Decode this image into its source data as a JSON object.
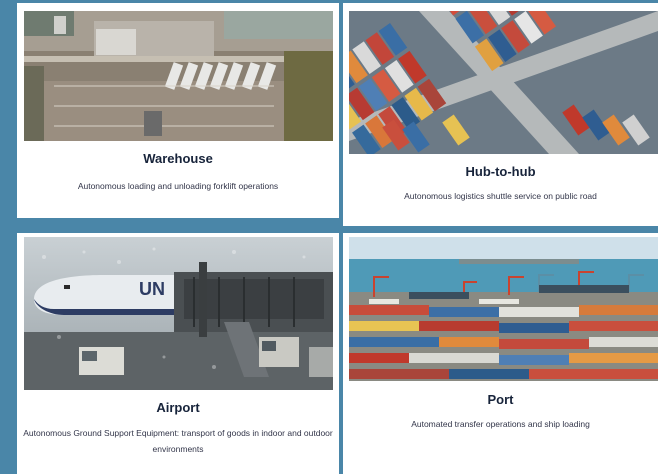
{
  "cards": [
    {
      "title": "Warehouse",
      "description": "Autonomous loading and unloading forklift operations",
      "image_alt": "Aerial view of a warehouse loading area with trucks"
    },
    {
      "title": "Hub-to-hub",
      "description": "Autonomous logistics shuttle service on public road",
      "image_alt": "Aerial view of stacked shipping containers"
    },
    {
      "title": "Airport",
      "description": "Autonomous Ground Support Equipment: transport of goods in indoor and outdoor environments",
      "image_alt": "Airplane at a gate on a rainy tarmac"
    },
    {
      "title": "Port",
      "description": "Automated transfer operations and ship loading",
      "image_alt": "Container port with cranes and ships"
    }
  ],
  "colors": {
    "background": "#4a86a8",
    "card": "#ffffff",
    "title": "#17233a",
    "text": "#33364a"
  }
}
